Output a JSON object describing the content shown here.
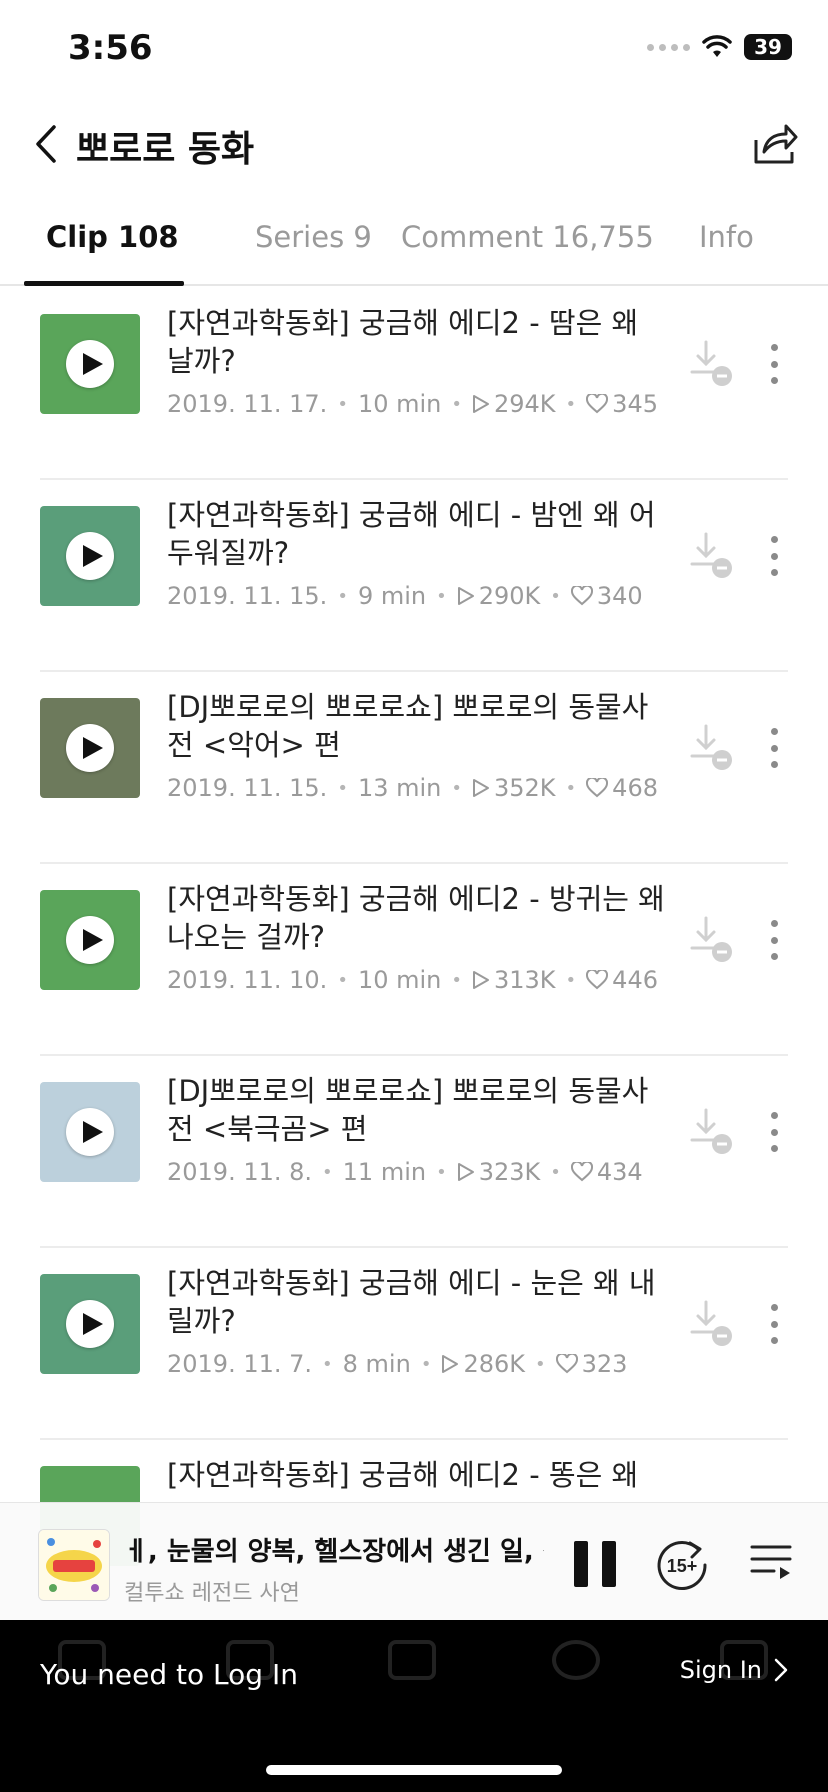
{
  "status": {
    "time": "3:56",
    "battery": "39"
  },
  "header": {
    "title": "뽀로로 동화"
  },
  "tabs": [
    {
      "label": "Clip 108",
      "active": true
    },
    {
      "label": "Series 9",
      "active": false
    },
    {
      "label": "Comment 16,755",
      "active": false
    },
    {
      "label": "Info",
      "active": false
    }
  ],
  "clips": [
    {
      "title": "[자연과학동화] 궁금해 에디2 - 땀은 왜 날까?",
      "date": "2019. 11. 17.",
      "duration": "10 min",
      "plays": "294K",
      "likes": "345",
      "thumb_color": "#5aa55a"
    },
    {
      "title": "[자연과학동화] 궁금해 에디 - 밤엔 왜 어두워질까?",
      "date": "2019. 11. 15.",
      "duration": "9 min",
      "plays": "290K",
      "likes": "340",
      "thumb_color": "#5a9e7a"
    },
    {
      "title": "[DJ뽀로로의 뽀로로쇼] 뽀로로의 동물사전 <악어> 편",
      "date": "2019. 11. 15.",
      "duration": "13 min",
      "plays": "352K",
      "likes": "468",
      "thumb_color": "#6d7a5c"
    },
    {
      "title": "[자연과학동화] 궁금해 에디2 - 방귀는 왜 나오는 걸까?",
      "date": "2019. 11. 10.",
      "duration": "10 min",
      "plays": "313K",
      "likes": "446",
      "thumb_color": "#5aa55a"
    },
    {
      "title": "[DJ뽀로로의 뽀로로쇼] 뽀로로의 동물사전 <북극곰> 편",
      "date": "2019. 11. 8.",
      "duration": "11 min",
      "plays": "323K",
      "likes": "434",
      "thumb_color": "#bcd0dc"
    },
    {
      "title": "[자연과학동화] 궁금해 에디 - 눈은 왜 내릴까?",
      "date": "2019. 11. 7.",
      "duration": "8 min",
      "plays": "286K",
      "likes": "323",
      "thumb_color": "#5a9e7a"
    },
    {
      "title": "[자연과학동화] 궁금해 에디2 - 똥은 왜",
      "date": "",
      "duration": "",
      "plays": "",
      "likes": "",
      "thumb_color": "#5aa55a"
    }
  ],
  "player": {
    "title": "ㅔ, 눈물의 양복, 헬스장에서 생긴 일, 작",
    "subtitle": "컬투쇼 레전드 사연",
    "skip_label": "15+"
  },
  "bottom": {
    "login_text": "You need to Log In",
    "signin_label": "Sign In"
  }
}
